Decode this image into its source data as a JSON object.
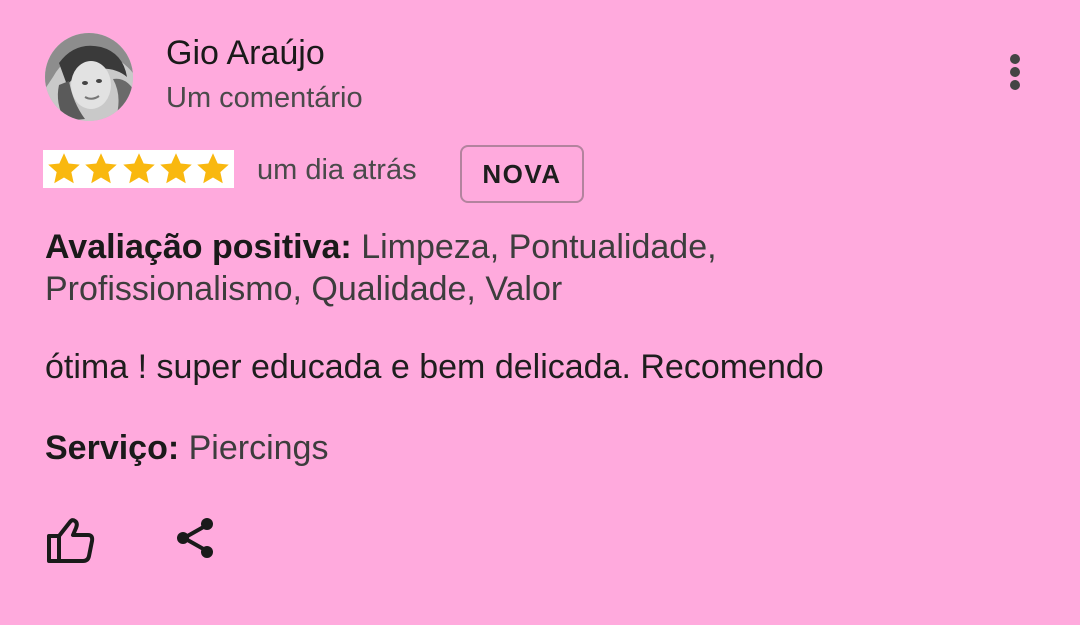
{
  "review": {
    "author_name": "Gio Araújo",
    "author_subtitle": "Um comentário",
    "rating": 5,
    "rating_max": 5,
    "time_ago": "um dia atrás",
    "badge": "NOVA",
    "positive_label": "Avaliação positiva:",
    "positive_line1": " Limpeza, Pontualidade,",
    "positive_line2": " Profissionalismo, Qualidade, Valor",
    "comment": "ótima ! super educada e bem delicada. Recomendo",
    "service_label": "Serviço:",
    "service_value": " Piercings"
  },
  "icons": {
    "more": "more-vert-icon",
    "star": "star-icon",
    "like": "thumb-up-icon",
    "share": "share-icon"
  },
  "colors": {
    "background": "#ffaadd",
    "star": "#f9b80f",
    "badge_border": "#b3839e"
  }
}
